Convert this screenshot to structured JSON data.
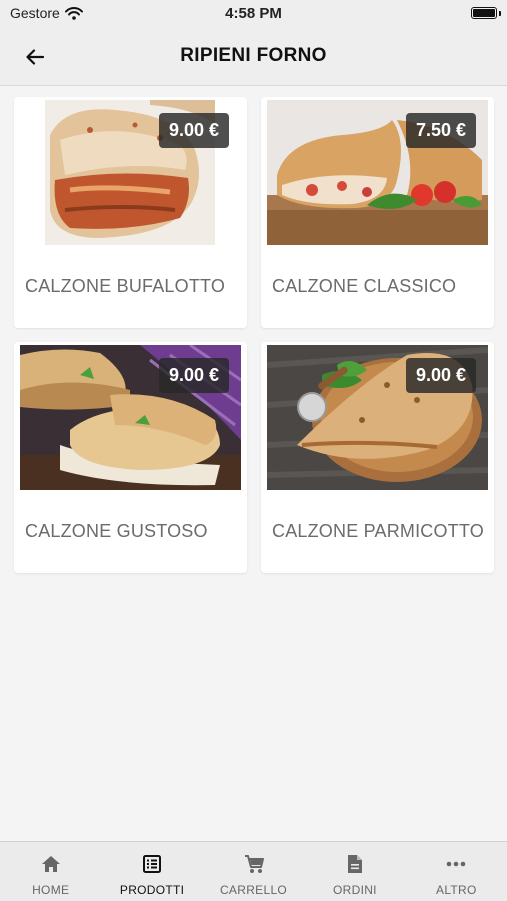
{
  "status_bar": {
    "carrier": "Gestore",
    "time": "4:58 PM"
  },
  "header": {
    "title": "RIPIENI FORNO"
  },
  "products": [
    {
      "name": "CALZONE BUFALOTTO",
      "price": "9.00 €"
    },
    {
      "name": "CALZONE CLASSICO",
      "price": "7.50 €"
    },
    {
      "name": "CALZONE GUSTOSO",
      "price": "9.00 €"
    },
    {
      "name": "CALZONE PARMICOTTO",
      "price": "9.00 €"
    }
  ],
  "tabs": [
    {
      "label": "HOME",
      "icon": "home-icon"
    },
    {
      "label": "PRODOTTI",
      "icon": "list-icon",
      "active": true
    },
    {
      "label": "CARRELLO",
      "icon": "cart-icon"
    },
    {
      "label": "ORDINI",
      "icon": "document-icon"
    },
    {
      "label": "ALTRO",
      "icon": "more-icon"
    }
  ],
  "colors": {
    "badge": "#282828",
    "tab_active": "#111111",
    "tab_inactive": "#666666"
  }
}
